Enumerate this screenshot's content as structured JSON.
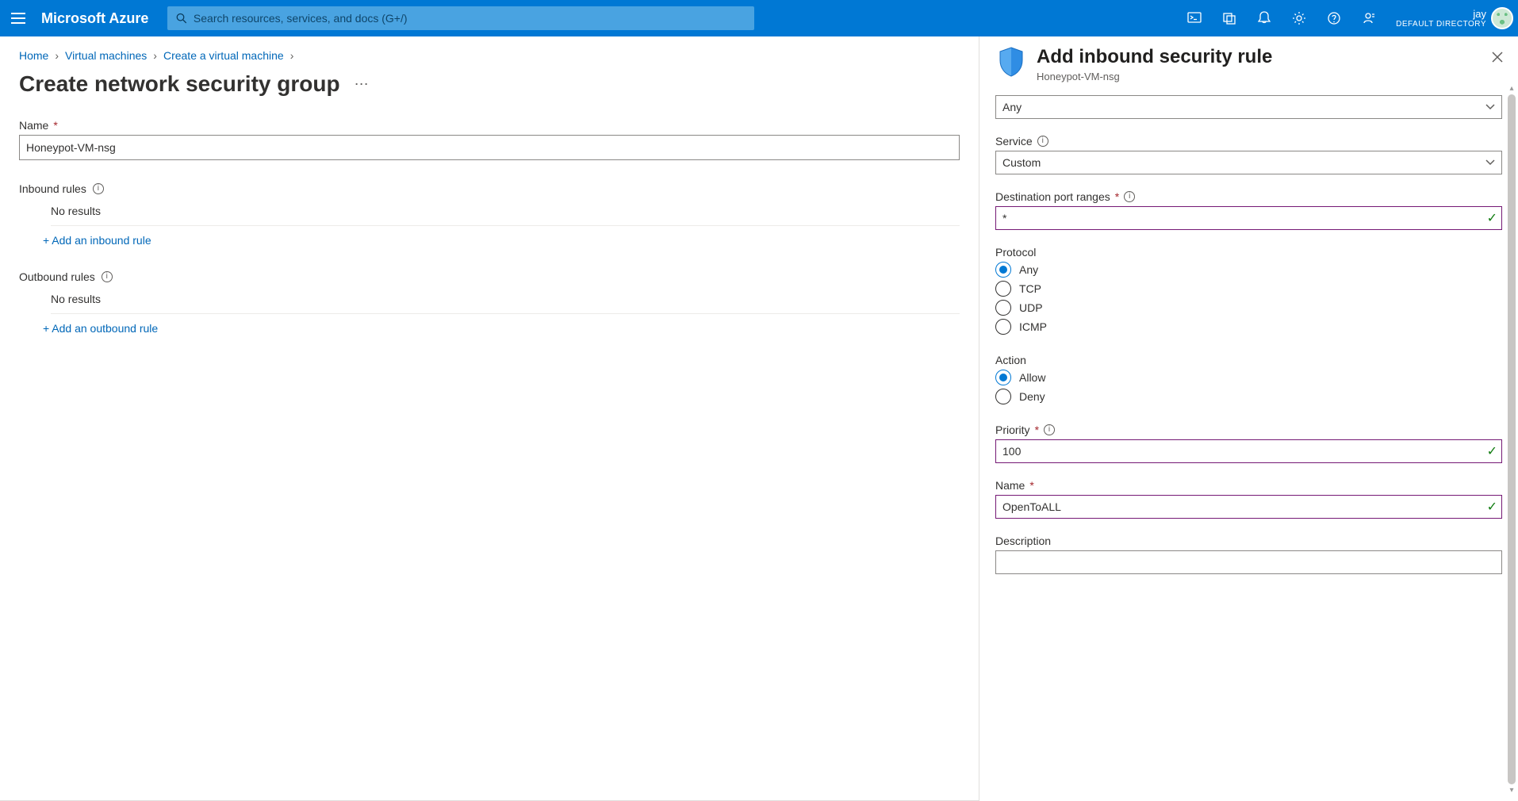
{
  "header": {
    "brand": "Microsoft Azure",
    "search_placeholder": "Search resources, services, and docs (G+/)",
    "user_name": "jay",
    "directory": "DEFAULT DIRECTORY"
  },
  "breadcrumbs": {
    "home": "Home",
    "vm": "Virtual machines",
    "create": "Create a virtual machine"
  },
  "page": {
    "title": "Create network security group",
    "name_label": "Name",
    "name_value": "Honeypot-VM-nsg",
    "inbound_section": "Inbound rules",
    "inbound_noresults": "No results",
    "inbound_add": "+ Add an inbound rule",
    "outbound_section": "Outbound rules",
    "outbound_noresults": "No results",
    "outbound_add": "+ Add an outbound rule"
  },
  "flyout": {
    "title": "Add inbound security rule",
    "subtitle": "Honeypot-VM-nsg",
    "source_value": "Any",
    "service_label": "Service",
    "service_value": "Custom",
    "dest_port_label": "Destination port ranges",
    "dest_port_value": "*",
    "protocol_label": "Protocol",
    "protocol_options": {
      "any": "Any",
      "tcp": "TCP",
      "udp": "UDP",
      "icmp": "ICMP"
    },
    "protocol_selected": "Any",
    "action_label": "Action",
    "action_options": {
      "allow": "Allow",
      "deny": "Deny"
    },
    "action_selected": "Allow",
    "priority_label": "Priority",
    "priority_value": "100",
    "name_label": "Name",
    "name_value": "OpenToALL",
    "description_label": "Description"
  }
}
